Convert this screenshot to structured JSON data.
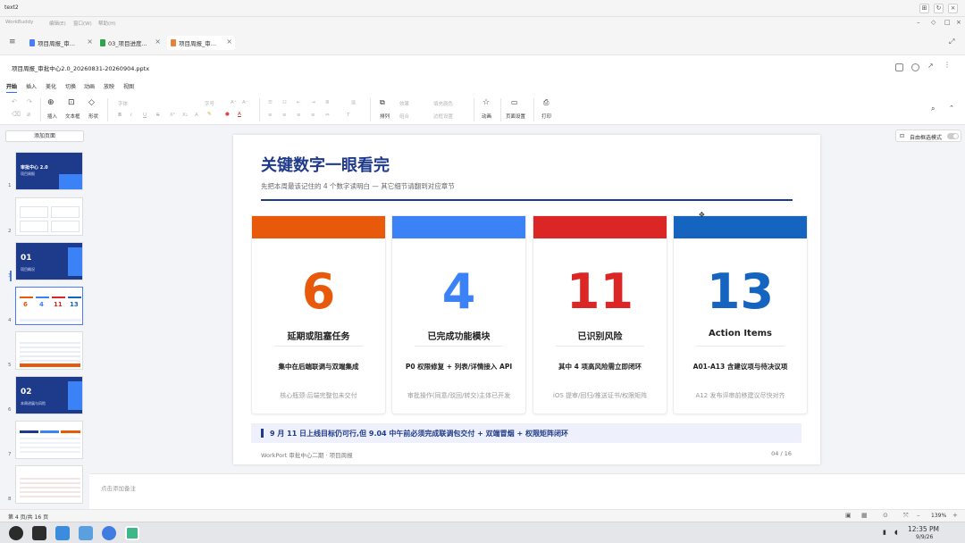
{
  "window": {
    "title": "text2"
  },
  "menu": {
    "items": [
      "WorkBuddy",
      "编辑(E)",
      "窗口(W)",
      "帮助(H)"
    ]
  },
  "tabs": [
    {
      "label": "项目周报_审...",
      "color": "#4a7cf7",
      "active": false
    },
    {
      "label": "03_项目进度...",
      "color": "#2ea44f",
      "active": false
    },
    {
      "label": "项目周报_审...",
      "color": "#e8833a",
      "active": true
    }
  ],
  "file": {
    "name": "项目周报_审批中心2.0_20260831-20260904.pptx"
  },
  "ribbon_tabs": [
    "开始",
    "插入",
    "美化",
    "切换",
    "动画",
    "放映",
    "视图"
  ],
  "ribbon": {
    "insert": "插入",
    "textbox": "文本框",
    "shape": "形状",
    "font_placeholder": "字体",
    "size_placeholder": "字号",
    "effect": "效果",
    "fill": "填充颜色",
    "combine": "组合",
    "border": "边框设置",
    "arrange": "排列",
    "animation": "动画",
    "page_setup": "页面设置",
    "print": "打印"
  },
  "sidebar": {
    "add_page": "添加页面",
    "thumbs": [
      {
        "num": "1",
        "title": "审批中心 2.0",
        "subtitle": "项目周报"
      },
      {
        "num": "2"
      },
      {
        "num": "3",
        "title": "01",
        "subtitle": "项目概况"
      },
      {
        "num": "4"
      },
      {
        "num": "5"
      },
      {
        "num": "6",
        "title": "02",
        "subtitle": "本周进展与风险"
      },
      {
        "num": "7"
      },
      {
        "num": "8"
      }
    ]
  },
  "mode_toggle": {
    "label": "自由框选模式"
  },
  "slide": {
    "title": "关键数字一眼看完",
    "subtitle": "先把本周最该记住的 4 个数字读明白 — 其它细节请翻到对应章节",
    "cards": [
      {
        "color": "#e8590c",
        "number": "6",
        "label": "延期或阻塞任务",
        "sub": "集中在后端联调与双端集成",
        "note": "核心瓶颈:后端完整包未交付"
      },
      {
        "color": "#3b82f6",
        "number": "4",
        "label": "已完成功能模块",
        "sub": "P0 权限修复 + 列表/详情接入 API",
        "note": "审批操作(同意/驳回/转交)主体已开发"
      },
      {
        "color": "#dc2626",
        "number": "11",
        "label": "已识别风险",
        "sub": "其中 4 项高风险需立即闭环",
        "note": "iOS 提审/回归/推送证书/权限矩阵"
      },
      {
        "color": "#1565c0",
        "number": "13",
        "label": "Action Items",
        "sub": "A01-A13 含建议项与待决议项",
        "note": "A12 发布评审前移建议尽快对齐"
      }
    ],
    "callout": "9 月 11 日上线目标仍可行,但 9.04 中午前必须完成联调包交付 + 双端冒烟 + 权限矩阵闭环",
    "footer": "WorkPort 审批中心二期 · 项目周报",
    "page": "04 / 16"
  },
  "notes": {
    "placeholder": "点击添加备注"
  },
  "status": {
    "page": "第 4 页/共 16 页",
    "zoom": "139%"
  },
  "taskbar": {
    "time": "12:35 PM",
    "date": "9/9/26"
  }
}
